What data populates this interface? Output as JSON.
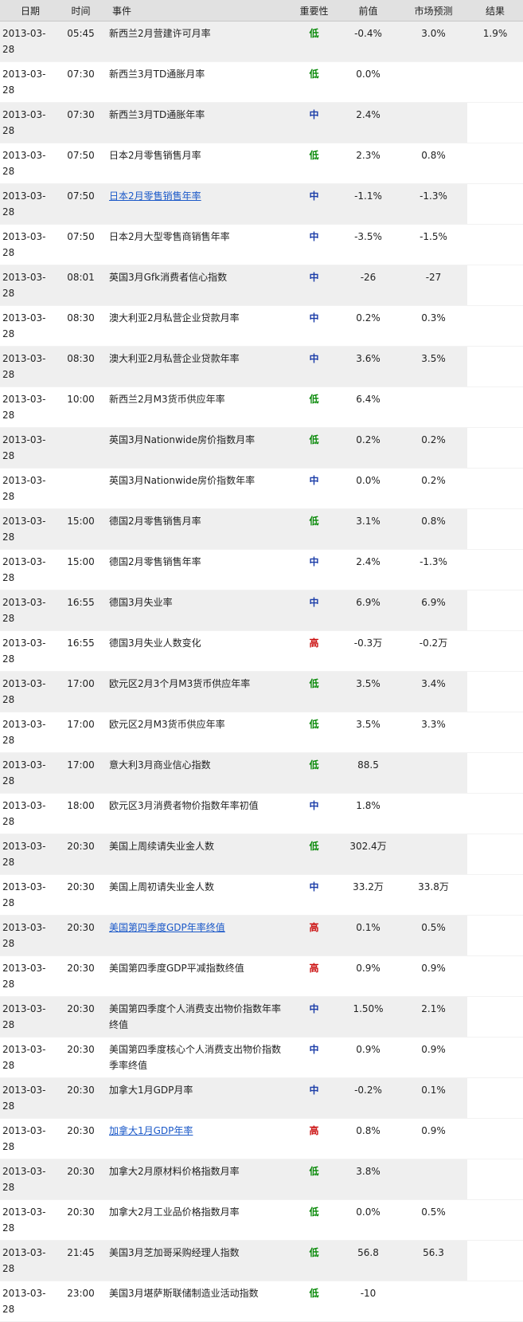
{
  "headers": {
    "date": "日期",
    "time": "时间",
    "event": "事件",
    "importance": "重要性",
    "previous": "前值",
    "forecast": "市场预测",
    "result": "结果"
  },
  "importance_colors": {
    "低": "#0a8a0a",
    "中": "#1a3ca8",
    "高": "#cc1111"
  },
  "rows": [
    {
      "date": "2013-03-28",
      "time": "05:45",
      "event": "新西兰2月营建许可月率",
      "importance": "低",
      "previous": "-0.4%",
      "forecast": "3.0%",
      "result": "1.9%",
      "link": false
    },
    {
      "date": "2013-03-28",
      "time": "07:30",
      "event": "新西兰3月TD通胀月率",
      "importance": "低",
      "previous": "0.0%",
      "forecast": "",
      "result": "",
      "link": false
    },
    {
      "date": "2013-03-28",
      "time": "07:30",
      "event": "新西兰3月TD通胀年率",
      "importance": "中",
      "previous": "2.4%",
      "forecast": "",
      "result": "",
      "link": false
    },
    {
      "date": "2013-03-28",
      "time": "07:50",
      "event": "日本2月零售销售月率",
      "importance": "低",
      "previous": "2.3%",
      "forecast": "0.8%",
      "result": "",
      "link": false
    },
    {
      "date": "2013-03-28",
      "time": "07:50",
      "event": "日本2月零售销售年率",
      "importance": "中",
      "previous": "-1.1%",
      "forecast": "-1.3%",
      "result": "",
      "link": true
    },
    {
      "date": "2013-03-28",
      "time": "07:50",
      "event": "日本2月大型零售商销售年率",
      "importance": "中",
      "previous": "-3.5%",
      "forecast": "-1.5%",
      "result": "",
      "link": false
    },
    {
      "date": "2013-03-28",
      "time": "08:01",
      "event": "英国3月Gfk消费者信心指数",
      "importance": "中",
      "previous": "-26",
      "forecast": "-27",
      "result": "",
      "link": false
    },
    {
      "date": "2013-03-28",
      "time": "08:30",
      "event": "澳大利亚2月私营企业贷款月率",
      "importance": "中",
      "previous": "0.2%",
      "forecast": "0.3%",
      "result": "",
      "link": false
    },
    {
      "date": "2013-03-28",
      "time": "08:30",
      "event": "澳大利亚2月私营企业贷款年率",
      "importance": "中",
      "previous": "3.6%",
      "forecast": "3.5%",
      "result": "",
      "link": false
    },
    {
      "date": "2013-03-28",
      "time": "10:00",
      "event": "新西兰2月M3货币供应年率",
      "importance": "低",
      "previous": "6.4%",
      "forecast": "",
      "result": "",
      "link": false
    },
    {
      "date": "2013-03-28",
      "time": "",
      "event": "英国3月Nationwide房价指数月率",
      "importance": "低",
      "previous": "0.2%",
      "forecast": "0.2%",
      "result": "",
      "link": false
    },
    {
      "date": "2013-03-28",
      "time": "",
      "event": "英国3月Nationwide房价指数年率",
      "importance": "中",
      "previous": "0.0%",
      "forecast": "0.2%",
      "result": "",
      "link": false
    },
    {
      "date": "2013-03-28",
      "time": "15:00",
      "event": "德国2月零售销售月率",
      "importance": "低",
      "previous": "3.1%",
      "forecast": "0.8%",
      "result": "",
      "link": false
    },
    {
      "date": "2013-03-28",
      "time": "15:00",
      "event": "德国2月零售销售年率",
      "importance": "中",
      "previous": "2.4%",
      "forecast": "-1.3%",
      "result": "",
      "link": false
    },
    {
      "date": "2013-03-28",
      "time": "16:55",
      "event": "德国3月失业率",
      "importance": "中",
      "previous": "6.9%",
      "forecast": "6.9%",
      "result": "",
      "link": false
    },
    {
      "date": "2013-03-28",
      "time": "16:55",
      "event": "德国3月失业人数变化",
      "importance": "高",
      "previous": "-0.3万",
      "forecast": "-0.2万",
      "result": "",
      "link": false
    },
    {
      "date": "2013-03-28",
      "time": "17:00",
      "event": "欧元区2月3个月M3货币供应年率",
      "importance": "低",
      "previous": "3.5%",
      "forecast": "3.4%",
      "result": "",
      "link": false
    },
    {
      "date": "2013-03-28",
      "time": "17:00",
      "event": "欧元区2月M3货币供应年率",
      "importance": "低",
      "previous": "3.5%",
      "forecast": "3.3%",
      "result": "",
      "link": false
    },
    {
      "date": "2013-03-28",
      "time": "17:00",
      "event": "意大利3月商业信心指数",
      "importance": "低",
      "previous": "88.5",
      "forecast": "",
      "result": "",
      "link": false
    },
    {
      "date": "2013-03-28",
      "time": "18:00",
      "event": "欧元区3月消费者物价指数年率初值",
      "importance": "中",
      "previous": "1.8%",
      "forecast": "",
      "result": "",
      "link": false
    },
    {
      "date": "2013-03-28",
      "time": "20:30",
      "event": "美国上周续请失业金人数",
      "importance": "低",
      "previous": "302.4万",
      "forecast": "",
      "result": "",
      "link": false
    },
    {
      "date": "2013-03-28",
      "time": "20:30",
      "event": "美国上周初请失业金人数",
      "importance": "中",
      "previous": "33.2万",
      "forecast": "33.8万",
      "result": "",
      "link": false
    },
    {
      "date": "2013-03-28",
      "time": "20:30",
      "event": "美国第四季度GDP年率终值",
      "importance": "高",
      "previous": "0.1%",
      "forecast": "0.5%",
      "result": "",
      "link": true
    },
    {
      "date": "2013-03-28",
      "time": "20:30",
      "event": "美国第四季度GDP平减指数终值",
      "importance": "高",
      "previous": "0.9%",
      "forecast": "0.9%",
      "result": "",
      "link": false
    },
    {
      "date": "2013-03-28",
      "time": "20:30",
      "event": "美国第四季度个人消费支出物价指数年率终值",
      "importance": "中",
      "previous": "1.50%",
      "forecast": "2.1%",
      "result": "",
      "link": false
    },
    {
      "date": "2013-03-28",
      "time": "20:30",
      "event": "美国第四季度核心个人消费支出物价指数季率终值",
      "importance": "中",
      "previous": "0.9%",
      "forecast": "0.9%",
      "result": "",
      "link": false
    },
    {
      "date": "2013-03-28",
      "time": "20:30",
      "event": "加拿大1月GDP月率",
      "importance": "中",
      "previous": "-0.2%",
      "forecast": "0.1%",
      "result": "",
      "link": false
    },
    {
      "date": "2013-03-28",
      "time": "20:30",
      "event": "加拿大1月GDP年率",
      "importance": "高",
      "previous": "0.8%",
      "forecast": "0.9%",
      "result": "",
      "link": true
    },
    {
      "date": "2013-03-28",
      "time": "20:30",
      "event": "加拿大2月原材料价格指数月率",
      "importance": "低",
      "previous": "3.8%",
      "forecast": "",
      "result": "",
      "link": false
    },
    {
      "date": "2013-03-28",
      "time": "20:30",
      "event": "加拿大2月工业品价格指数月率",
      "importance": "低",
      "previous": "0.0%",
      "forecast": "0.5%",
      "result": "",
      "link": false
    },
    {
      "date": "2013-03-28",
      "time": "21:45",
      "event": "美国3月芝加哥采购经理人指数",
      "importance": "低",
      "previous": "56.8",
      "forecast": "56.3",
      "result": "",
      "link": false
    },
    {
      "date": "2013-03-28",
      "time": "23:00",
      "event": "美国3月堪萨斯联储制造业活动指数",
      "importance": "低",
      "previous": "-10",
      "forecast": "",
      "result": "",
      "link": false
    }
  ]
}
